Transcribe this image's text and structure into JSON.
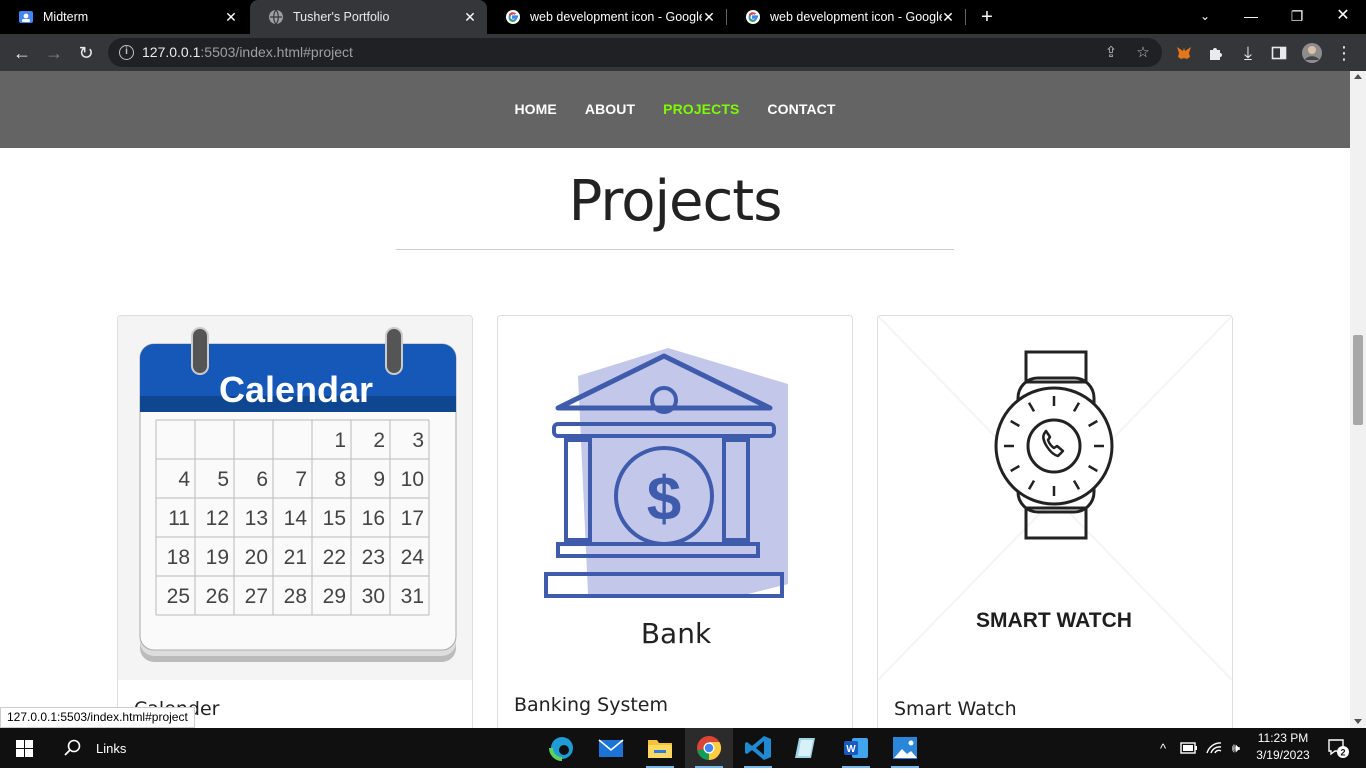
{
  "browser": {
    "tabs": [
      {
        "label": "Midterm",
        "icon": "google-classroom-icon"
      },
      {
        "label": "Tusher's Portfolio",
        "icon": "globe-icon"
      },
      {
        "label": "web development icon - Google",
        "icon": "google-icon"
      },
      {
        "label": "web development icon - Google",
        "icon": "google-icon"
      }
    ],
    "url_host": "127.0.0.1",
    "url_rest": ":5503/index.html#project",
    "status_url": "127.0.0.1:5503/index.html#project"
  },
  "nav": {
    "home": "HOME",
    "about": "ABOUT",
    "projects": "PROJECTS",
    "contact": "CONTACT",
    "active_color": "#7cfc00"
  },
  "page": {
    "title": "Projects",
    "cards": [
      {
        "title": "Calender",
        "image": {
          "header": "Calendar",
          "days": [
            "1",
            "2",
            "3",
            "4",
            "5",
            "6",
            "7",
            "8",
            "9",
            "10",
            "11",
            "12",
            "13",
            "14",
            "15",
            "16",
            "17",
            "18",
            "19",
            "20",
            "21",
            "22",
            "23",
            "24",
            "25",
            "26",
            "27",
            "28",
            "29",
            "30",
            "31"
          ]
        }
      },
      {
        "title": "Banking System",
        "image": {
          "caption": "Bank"
        }
      },
      {
        "title": "Smart Watch",
        "image": {
          "caption": "SMART WATCH"
        }
      }
    ]
  },
  "taskbar": {
    "search_label": "Links",
    "time": "11:23 PM",
    "date": "3/19/2023",
    "notifications": "2"
  }
}
